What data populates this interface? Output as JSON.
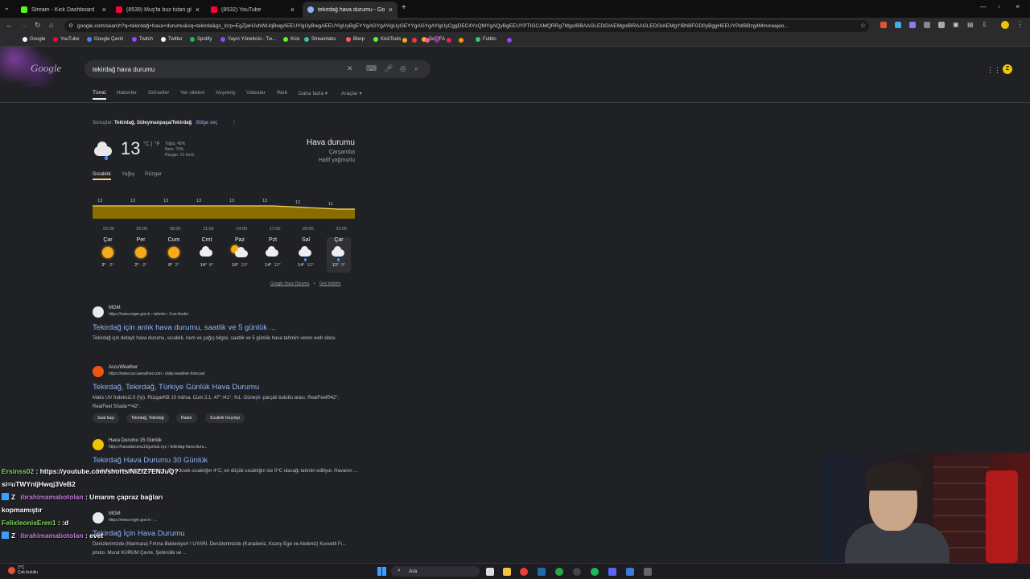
{
  "browser": {
    "tabs": [
      {
        "label": "Stream - Kick Dashboard",
        "color": "#53fc18"
      },
      {
        "label": "(8539) Muş'ta buz tutan gölette",
        "color": "#ff0033"
      },
      {
        "label": "(8532) YouTube",
        "color": "#ff0033"
      },
      {
        "label": "tekirdağ hava durumu - Google",
        "color": "#8ab4f8"
      }
    ],
    "new_tab": "+",
    "url": "google.com/search?q=tekirdağ+hava+durumu&oq=tekirda&gs_lcrp=EgZjaHJvbWUqBwgAEEUYigUyBwgAEEUYigUyBgEYYgAGYgAYigUyGEYYgAGYgAYigUyCggDEC4YsQMYgAQyBgEEUYPTIGCAMQRRg7MgoIBBAAGLEDGIAEMgoIBRAAGLEDGIAEMgYIBhBFGD0yBggHEEUYPdIBBzg4Mmowajeo..."
  },
  "bookmarks": [
    {
      "label": "Google",
      "color": "#ffffff"
    },
    {
      "label": "YouTube",
      "color": "#ff0033"
    },
    {
      "label": "Google Çeviri",
      "color": "#4285f4"
    },
    {
      "label": "Twitch",
      "color": "#9146ff"
    },
    {
      "label": "Twitter",
      "color": "#ffffff"
    },
    {
      "label": "Spotify",
      "color": "#1db954"
    },
    {
      "label": "Yayın Yöneticisi - Tw...",
      "color": "#9146ff"
    },
    {
      "label": "Kick",
      "color": "#53fc18"
    },
    {
      "label": "Streamlabs",
      "color": "#31c3a2"
    },
    {
      "label": "Blerp",
      "color": "#ff5a5f"
    },
    {
      "label": "KickTools",
      "color": "#53fc18"
    },
    {
      "label": "SoFIFA",
      "color": "#f5a623"
    },
    {
      "label": "Futbin",
      "color": "#2ecc71"
    }
  ],
  "google": {
    "logo": "Google",
    "query": "tekirdağ hava durumu",
    "avatar": "Z",
    "tabs": [
      "Tümü",
      "Haberler",
      "Görseller",
      "Yer siteleri",
      "Alışveriş",
      "Videolar",
      "Web",
      "Daha fazla ▾",
      "Araçlar ▾"
    ]
  },
  "weather": {
    "location_prefix": "Sonuçlar:",
    "location": "Tekirdağ, Süleymanpaşa/Tekirdağ",
    "region_link": "Bölge seç",
    "temp": "13",
    "units": "°C | °F",
    "precip": "Yağış: 45%",
    "humidity": "Nem: 76%",
    "wind": "Rüzgar: 21 km/s",
    "title": "Hava durumu",
    "day": "Çarşamba",
    "condition": "Hafif yağmurlu",
    "subtabs": [
      "Sıcaklık",
      "Yağış",
      "Rüzgar"
    ],
    "chart": {
      "hours": [
        "02:00",
        "05:00",
        "08:00",
        "11:00",
        "14:00",
        "17:00",
        "20:00",
        "23:00"
      ],
      "values": [
        13,
        13,
        13,
        13,
        13,
        13,
        12,
        11
      ],
      "fill": "#8a6d00",
      "line": "#fdd663"
    },
    "days": [
      {
        "name": "Çar",
        "icon": "sun",
        "hi": "3°",
        "lo": "-2°"
      },
      {
        "name": "Per",
        "icon": "sun",
        "hi": "2°",
        "lo": "-2°"
      },
      {
        "name": "Cum",
        "icon": "sun",
        "hi": "8°",
        "lo": "2°"
      },
      {
        "name": "Cmt",
        "icon": "cloud",
        "hi": "14°",
        "lo": "8°"
      },
      {
        "name": "Paz",
        "icon": "partly",
        "hi": "16°",
        "lo": "13°"
      },
      {
        "name": "Pzt",
        "icon": "cloud",
        "hi": "14°",
        "lo": "12°"
      },
      {
        "name": "Sal",
        "icon": "rain",
        "hi": "14°",
        "lo": "12°"
      },
      {
        "name": "Çar",
        "icon": "rain",
        "hi": "13°",
        "lo": "9°"
      }
    ],
    "source": "Google Hava Durumu",
    "feedback": "Geri bildirim"
  },
  "results": [
    {
      "site": "MGM",
      "url": "https://www.mgm.gov.tr › tahmin › il-ve-ilceler",
      "title": "Tekirdağ için anlık hava durumu, saatlik ve 5 günlük ...",
      "desc": "Tekirdağ için detaylı hava durumu, sıcaklık, nem ve yağış bilgisi, saatlik ve 5 günlük hava tahmini veren web sitesi.",
      "fav": "#e8eaed"
    },
    {
      "site": "AccuWeather",
      "url": "https://www.accuweather.com › daily-weather-forecast",
      "title": "Tekirdağ, Tekirdağ, Türkiye Günlük Hava Durumu",
      "desc": "Maks UV İndeksi2.0 (İyi). RüzgarKB 10 mil/sa. Cum 2.1. 47° /41°. %1. Güneşli- parçalı bulutlu arası. RealFeel®42°. RealFeel Shade™42°.",
      "fav": "#f05514",
      "chips": [
        "Saat başı",
        "Tekirdağ, Tekirdağ",
        "Radar",
        "Sıcaklık Geçmişi"
      ]
    },
    {
      "site": "Hava Durumu 15 Günlük",
      "url": "https://havadurumu15gunluk.xyz › tekirdag-hava-duru...",
      "title": "Tekirdağ Hava Durumu 30 Günlük",
      "desc": "...bulutlu ve don olması bekleniyor. En yüksek sıcaklığın 4°C, en düşük sıcaklığın ise 0°C olacağı tahmin ediliyor. Havanın ...",
      "fav": "#f2c200"
    },
    {
      "site": "MGM",
      "url": "https://www.mgm.gov.tr › ...",
      "title": "Tekirdağ İçin Hava Durumu",
      "desc": "Denizlerimizde (Marmara) Fırtına Bekleniyor! ! UYARI. Denizlerimizde (Karadeniz, Kuzey Ege ve Akdeniz) Kuvvetli Fı... photo. Murat KURUM Çevre, Şehircilik ve ...",
      "fav": "#e8eaed"
    }
  ],
  "chat": [
    {
      "user": "Ersinss02",
      "msg": ": https://youtube.com/shorts/NiZfZ7ENJuQ?"
    },
    {
      "user": "",
      "msg": "si=uTWYnIjHwqj3VeB2"
    },
    {
      "user": "ibrahimamabotolan",
      "msg": ": Umarım çapraz bağları",
      "badge": "Z"
    },
    {
      "user": "",
      "msg": "kopmamıştır"
    },
    {
      "user": "FelixleonisEren1",
      "msg": ": :d"
    },
    {
      "user": "ibrahimamabotolan",
      "msg": ": evet",
      "badge": "Z"
    }
  ],
  "taskbar": {
    "weather_temp": "2°C",
    "weather_desc": "Çok bulutlu",
    "search": "Ara"
  }
}
